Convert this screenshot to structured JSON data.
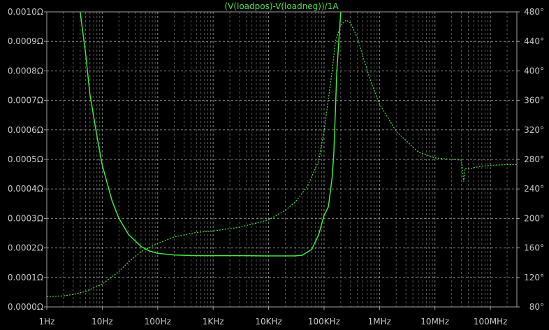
{
  "chart_data": {
    "type": "line",
    "title": "(V(loadpos)-V(loadneg))/1A",
    "background": "#000000",
    "trace_color": "#3ee83e",
    "title_color": "#4be04b",
    "grid": true,
    "x_scale": "log",
    "xlim": [
      1,
      300000000
    ],
    "x_ticks": [
      "1Hz",
      "10Hz",
      "100Hz",
      "1KHz",
      "10KHz",
      "100KHz",
      "1MHz",
      "10MHz",
      "100MHz"
    ],
    "x_tick_values": [
      1,
      10,
      100,
      1000,
      10000,
      100000,
      1000000,
      10000000,
      100000000
    ],
    "ylim_left": [
      0,
      0.001
    ],
    "y_ticks_left": [
      "0.0000Ω",
      "0.0001Ω",
      "0.0002Ω",
      "0.0003Ω",
      "0.0004Ω",
      "0.0005Ω",
      "0.0006Ω",
      "0.0007Ω",
      "0.0008Ω",
      "0.0009Ω",
      "0.0010Ω"
    ],
    "y_tick_values_left": [
      0,
      0.0001,
      0.0002,
      0.0003,
      0.0004,
      0.0005,
      0.0006,
      0.0007,
      0.0008,
      0.0009,
      0.001
    ],
    "ylim_right": [
      80,
      480
    ],
    "y_ticks_right": [
      "80°",
      "120°",
      "160°",
      "200°",
      "240°",
      "280°",
      "320°",
      "360°",
      "400°",
      "440°",
      "480°"
    ],
    "y_tick_values_right": [
      80,
      120,
      160,
      200,
      240,
      280,
      320,
      360,
      400,
      440,
      480
    ],
    "series": [
      {
        "style": "solid",
        "axis": "left",
        "x": [
          4,
          5,
          6,
          8,
          10,
          15,
          20,
          30,
          50,
          70,
          100,
          200,
          500,
          1000,
          3000,
          10000,
          30000,
          40000,
          60000,
          80000,
          100000,
          120000,
          140000,
          150000,
          170000,
          200000
        ],
        "y": [
          0.001,
          0.00086,
          0.00072,
          0.00058,
          0.00048,
          0.00036,
          0.0003,
          0.000245,
          0.000205,
          0.00019,
          0.000182,
          0.000176,
          0.000174,
          0.000174,
          0.000174,
          0.000173,
          0.000173,
          0.000175,
          0.000195,
          0.000245,
          0.00031,
          0.00034,
          0.00044,
          0.00052,
          0.0008,
          0.001
        ]
      },
      {
        "style": "dashed",
        "axis": "right",
        "x": [
          1,
          2,
          3,
          5,
          10,
          20,
          30,
          50,
          100,
          200,
          500,
          1000,
          3000,
          10000,
          20000,
          30000,
          50000,
          80000,
          100000,
          140000,
          160000,
          200000,
          250000,
          300000,
          400000,
          500000,
          700000,
          1000000,
          2000000,
          5000000,
          10000000,
          20000000,
          30000000,
          33000000,
          35000000,
          40000000,
          60000000,
          100000000,
          200000000,
          300000000
        ],
        "y": [
          94,
          95,
          97,
          101,
          111,
          128,
          141,
          155,
          166,
          175,
          181,
          183,
          188,
          198,
          211,
          222,
          243,
          278,
          318,
          400,
          440,
          462,
          469,
          465,
          445,
          420,
          385,
          355,
          318,
          290,
          282,
          280,
          279,
          250,
          268,
          267,
          270,
          272,
          273,
          273
        ]
      }
    ]
  }
}
